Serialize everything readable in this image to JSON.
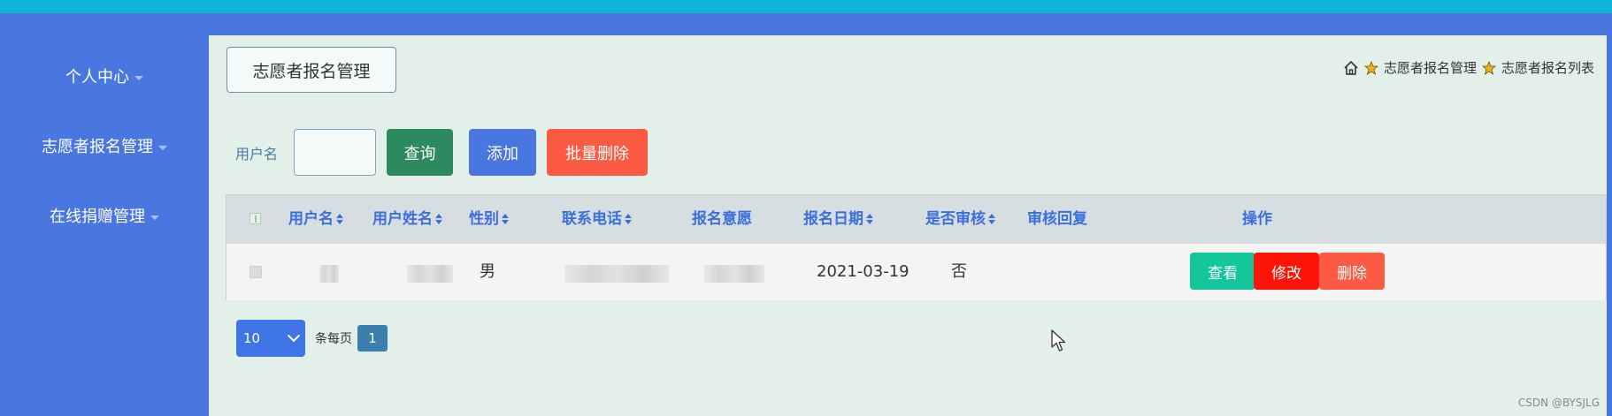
{
  "sidebar": {
    "items": [
      {
        "label": "个人中心"
      },
      {
        "label": "志愿者报名管理"
      },
      {
        "label": "在线捐赠管理"
      }
    ]
  },
  "header": {
    "title": "志愿者报名管理"
  },
  "breadcrumb": {
    "items": [
      "志愿者报名管理",
      "志愿者报名列表"
    ]
  },
  "search": {
    "label": "用户名",
    "value": "",
    "query_label": "查询",
    "add_label": "添加",
    "batch_delete_label": "批量删除"
  },
  "table": {
    "columns": [
      "用户名",
      "用户姓名",
      "性别",
      "联系电话",
      "报名意愿",
      "报名日期",
      "是否审核",
      "审核回复",
      "操作"
    ],
    "rows": [
      {
        "gender": "男",
        "date": "2021-03-19",
        "audited": "否",
        "reply": "",
        "actions": {
          "view": "查看",
          "edit": "修改",
          "delete": "删除"
        }
      }
    ]
  },
  "pagination": {
    "page_size": "10",
    "per_page_label": "条每页",
    "current_page": "1"
  },
  "watermark": "CSDN @BYSJLG",
  "colors": {
    "topbar": "#4a76e0",
    "accent_strip": "#0fb2d8",
    "content_bg": "#e3f0ea",
    "query_button": "#2d8a5e",
    "add_button": "#4a76e0",
    "batch_delete_button": "#fc5a42",
    "view_button": "#14c69b",
    "edit_button": "#fc1408",
    "delete_button": "#fc5a42"
  }
}
